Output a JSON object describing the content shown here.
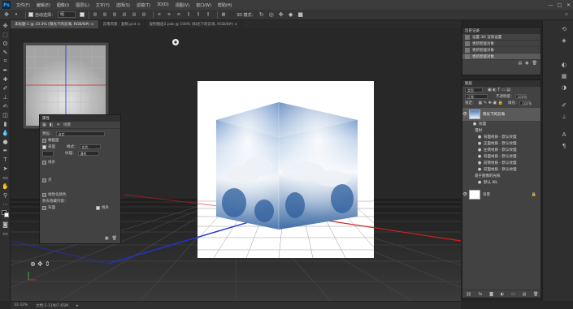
{
  "app": {
    "logo": "Ps",
    "menus": [
      "文件(F)",
      "编辑(E)",
      "图像(I)",
      "图层(L)",
      "文字(Y)",
      "选择(S)",
      "滤镜(T)",
      "3D(D)",
      "视图(V)",
      "窗口(W)",
      "帮助(H)"
    ],
    "window_controls": [
      "—",
      "□",
      "✕"
    ]
  },
  "options_bar": {
    "auto_select_label": "自动选择：",
    "auto_select_value": "组",
    "mode_3d_label": "3D 模式："
  },
  "tabs": [
    {
      "label": "未标题-1 @ 33.3% (阳光下的云海, RGB/8#) ×",
      "active": true
    },
    {
      "label": "云南风景 - 复制.psd ×",
      "active": false
    },
    {
      "label": "复制图层2.psb @ 100% (阳光下的云海, RGB/8#) ×",
      "active": false
    }
  ],
  "statusbar": {
    "zoom": "33.33%",
    "doc": "文档:2.11M/7.65M"
  },
  "history": {
    "title": "历史记录",
    "items": [
      "设置 3D 渲染设置",
      "更新智能对象",
      "更新智能对象",
      "更新智能对象"
    ]
  },
  "layers": {
    "title": "图层",
    "kind_label": "类型",
    "blend_mode": "正常",
    "opacity_label": "不透明度：",
    "opacity_value": "100%",
    "lock_label": "锁定：",
    "fill_label": "填充：",
    "fill_value": "100%",
    "layer_name": "阳光下的云海",
    "sub_items": [
      "纹理",
      "漫射",
      "背面材质 - 默认纹理",
      "正面材质 - 默认纹理",
      "左侧材质 - 默认纹理",
      "背面材质 - 默认纹理",
      "前侧材质 - 默认纹理",
      "前面材质 - 默认纹理",
      "基于图像的光照",
      "默认 IBL"
    ],
    "background_name": "背景"
  },
  "properties": {
    "title": "属性",
    "tab_label": "场景",
    "preset_label": "预设：",
    "preset_value": "自定",
    "cross_section_label": "横截面",
    "surface_label": "表面",
    "style_label": "样式：",
    "style_value": "实色",
    "texture_label": "纹理：",
    "texture_value": "漫射",
    "lines_label": "线条",
    "points_label": "点",
    "linearize_label": "线性化颜色",
    "remove_hidden_label": "移去隐藏内容：",
    "backface_label": "背面",
    "lines2_label": "线条"
  }
}
